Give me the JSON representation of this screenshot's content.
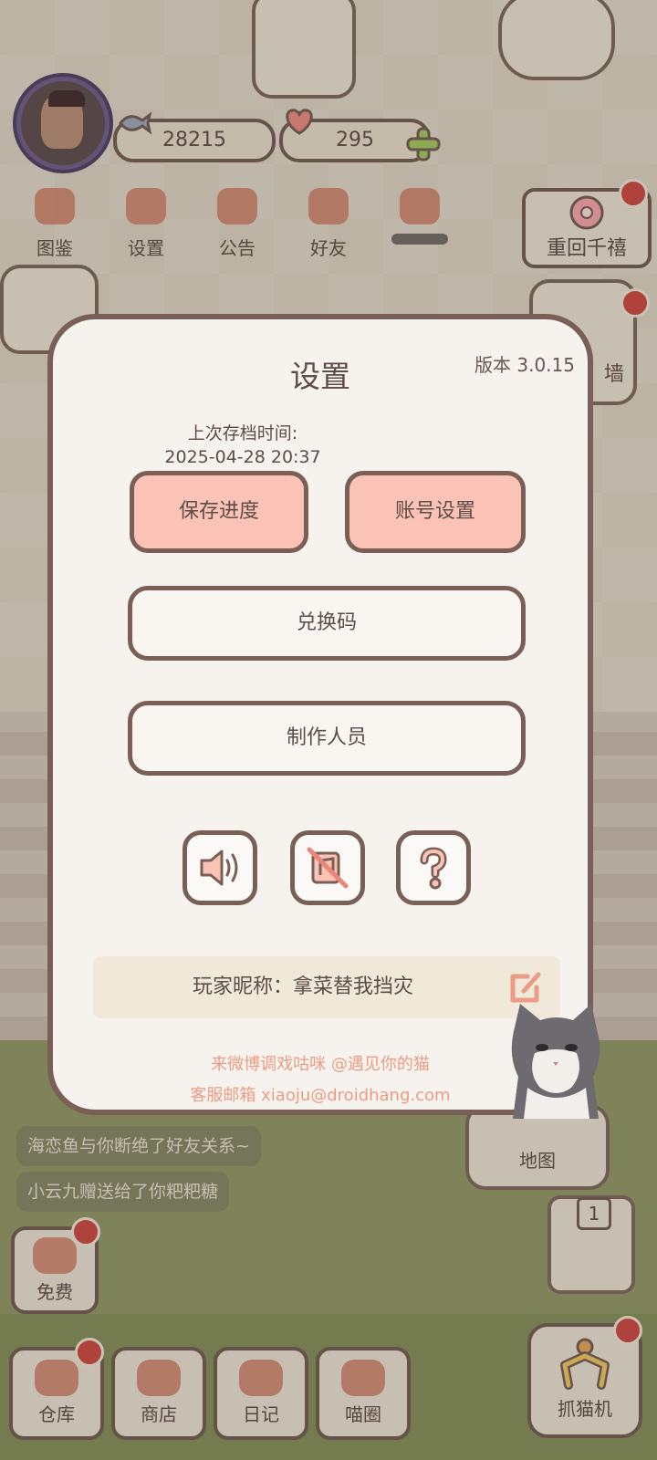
{
  "hud": {
    "coins": "28215",
    "hearts": "295",
    "nav": [
      {
        "label": "图鉴",
        "icon": "cat-book-icon"
      },
      {
        "label": "设置",
        "icon": "gear-icon"
      },
      {
        "label": "公告",
        "icon": "gift-icon"
      },
      {
        "label": "好友",
        "icon": "friends-icon"
      },
      {
        "label": "",
        "icon": "heart-mail-icon"
      }
    ],
    "reunion_label": "重回千禧",
    "wall_label": "墙",
    "map_label": "地图",
    "claw_count": "1",
    "claw_label": "抓猫机"
  },
  "feed": [
    "海恋鱼与你断绝了好友关系~",
    "小云九赠送给了你粑粑糖"
  ],
  "bottom_bar": [
    {
      "label": "免费",
      "icon": "heart-box-icon"
    },
    {
      "label": "仓库",
      "icon": "storage-icon"
    },
    {
      "label": "商店",
      "icon": "shop-icon"
    },
    {
      "label": "日记",
      "icon": "diary-icon"
    },
    {
      "label": "喵圈",
      "icon": "cat-planet-icon"
    }
  ],
  "dialog": {
    "title": "设置",
    "version": "版本 3.0.15",
    "last_save_label": "上次存档时间:",
    "last_save_time": "2025-04-28 20:37",
    "save_button": "保存进度",
    "account_button": "账号设置",
    "redeem_button": "兑换码",
    "credits_button": "制作人员",
    "nickname_text": "玩家昵称：拿菜替我挡灾",
    "footer_weibo": "来微博调戏咕咪 @遇见你的猫",
    "footer_email": "客服邮箱 xiaoju@droidhang.com"
  },
  "colors": {
    "dialog_bg": "#f6f3ee",
    "border": "#7a5f56",
    "pink_button": "#fbc3b5",
    "footer_text": "#ec9c84",
    "badge_red": "#c8463e"
  }
}
